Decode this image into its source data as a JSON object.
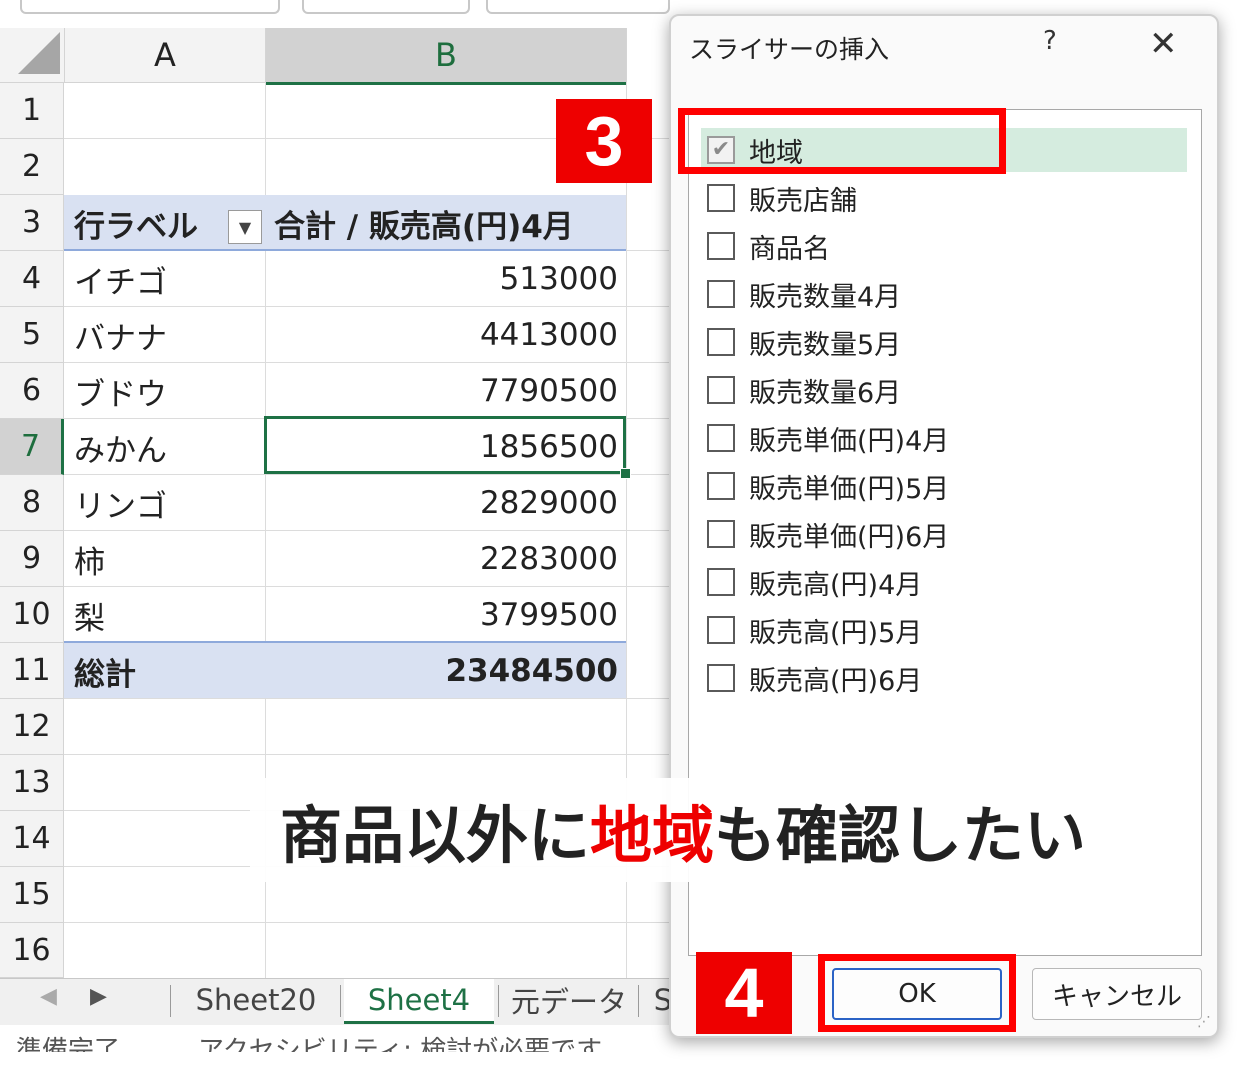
{
  "sheet": {
    "columns": [
      "A",
      "B"
    ],
    "rows": [
      "1",
      "2",
      "3",
      "4",
      "5",
      "6",
      "7",
      "8",
      "9",
      "10",
      "11",
      "12",
      "13",
      "14",
      "15",
      "16"
    ],
    "pivot": {
      "row_label_header": "行ラベル",
      "value_header": "合計 / 販売高(円)4月",
      "filter_icon": "dropdown-arrow-icon",
      "rows": [
        {
          "label": "イチゴ",
          "value": "513000"
        },
        {
          "label": "バナナ",
          "value": "4413000"
        },
        {
          "label": "ブドウ",
          "value": "7790500"
        },
        {
          "label": "みかん",
          "value": "1856500"
        },
        {
          "label": "リンゴ",
          "value": "2829000"
        },
        {
          "label": "柿",
          "value": "2283000"
        },
        {
          "label": "梨",
          "value": "3799500"
        }
      ],
      "total_label": "総計",
      "total_value": "23484500"
    },
    "tabs": [
      "Sheet20",
      "Sheet4",
      "元データ",
      "S"
    ],
    "active_tab": "Sheet4",
    "status_text": "準備完了　　　アクセシビリティ: 検討が必要です"
  },
  "dialog": {
    "title": "スライサーの挿入",
    "help": "?",
    "close": "✕",
    "fields": [
      {
        "label": "地域",
        "checked": true
      },
      {
        "label": "販売店舗",
        "checked": false
      },
      {
        "label": "商品名",
        "checked": false
      },
      {
        "label": "販売数量4月",
        "checked": false
      },
      {
        "label": "販売数量5月",
        "checked": false
      },
      {
        "label": "販売数量6月",
        "checked": false
      },
      {
        "label": "販売単価(円)4月",
        "checked": false
      },
      {
        "label": "販売単価(円)5月",
        "checked": false
      },
      {
        "label": "販売単価(円)6月",
        "checked": false
      },
      {
        "label": "販売高(円)4月",
        "checked": false
      },
      {
        "label": "販売高(円)5月",
        "checked": false
      },
      {
        "label": "販売高(円)6月",
        "checked": false
      }
    ],
    "ok_label": "OK",
    "cancel_label": "キャンセル"
  },
  "annotations": {
    "step3": "3",
    "step4": "4",
    "caption_before": "商品以外に",
    "caption_highlight": "地域",
    "caption_after": "も確認したい"
  },
  "colors": {
    "accent_green": "#1e7145",
    "pivot_band": "#d9e1f2",
    "annotation_red": "#ee0000",
    "listbox_highlight": "#d5ecdf"
  }
}
